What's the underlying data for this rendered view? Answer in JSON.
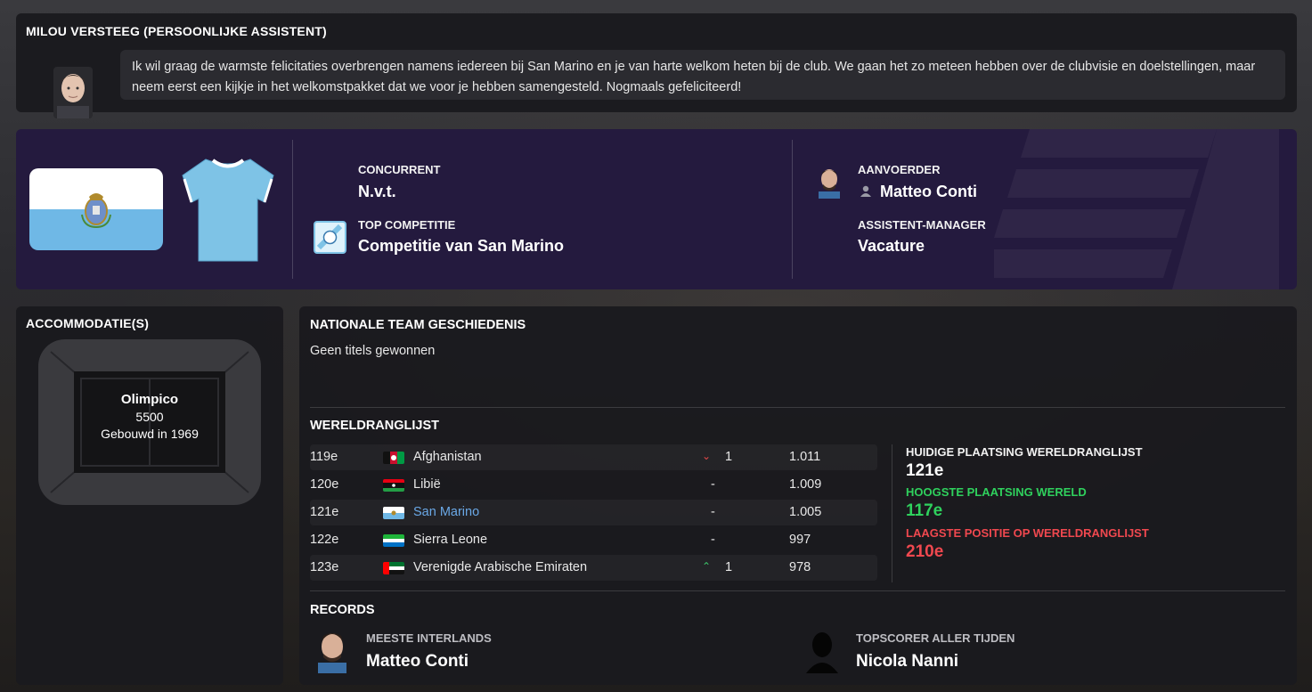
{
  "assistant_message": {
    "title": "MILOU VERSTEEG (PERSOONLIJKE ASSISTENT)",
    "text": "Ik wil graag de warmste felicitaties overbrengen namens iedereen bij San Marino en je van harte welkom heten bij de club. We gaan het zo meteen hebben over de clubvisie en doelstellingen, maar neem eerst een kijkje in het welkomstpakket dat we voor je hebben samengesteld. Nogmaals gefeliciteerd!"
  },
  "club_banner": {
    "rival_label": "CONCURRENT",
    "rival_value": "N.v.t.",
    "competition_label": "TOP COMPETITIE",
    "competition_value": "Competitie van San Marino",
    "captain_label": "AANVOERDER",
    "captain_value": "Matteo Conti",
    "assistant_manager_label": "ASSISTENT-MANAGER",
    "assistant_manager_value": "Vacature",
    "colors": {
      "banner": "#241a3e",
      "shirt": "#7ec3e6"
    }
  },
  "accommodation": {
    "title": "ACCOMMODATIE(S)",
    "stadium_name": "Olimpico",
    "capacity": "5500",
    "built": "Gebouwd in 1969"
  },
  "history": {
    "title": "NATIONALE TEAM GESCHIEDENIS",
    "text": "Geen titels gewonnen"
  },
  "world_ranking": {
    "title": "WERELDRANGLIJST",
    "rows": [
      {
        "pos": "119e",
        "country": "Afghanistan",
        "flag": "flag-afghanistan",
        "trend": "down",
        "move": "1",
        "points": "1.011"
      },
      {
        "pos": "120e",
        "country": "Libië",
        "flag": "flag-libya",
        "trend": "none",
        "move": "-",
        "points": "1.009"
      },
      {
        "pos": "121e",
        "country": "San Marino",
        "flag": "flag-san-marino",
        "trend": "none",
        "move": "-",
        "points": "1.005"
      },
      {
        "pos": "122e",
        "country": "Sierra Leone",
        "flag": "flag-sierra-leone",
        "trend": "none",
        "move": "-",
        "points": "997"
      },
      {
        "pos": "123e",
        "country": "Verenigde Arabische Emiraten",
        "flag": "flag-uae",
        "trend": "up",
        "move": "1",
        "points": "978"
      }
    ],
    "current_label": "HUIDIGE PLAATSING WERELDRANGLIJST",
    "current_value": "121e",
    "highest_label": "HOOGSTE PLAATSING WERELD",
    "highest_value": "117e",
    "lowest_label": "LAAGSTE POSITIE OP WERELDRANGLIJST",
    "lowest_value": "210e",
    "colors": {
      "highest": "#2fd15d",
      "lowest": "#f0484f"
    }
  },
  "records": {
    "title": "RECORDS",
    "most_caps_label": "MEESTE INTERLANDS",
    "most_caps_value": "Matteo Conti",
    "top_scorer_label": "TOPSCORER ALLER TIJDEN",
    "top_scorer_value": "Nicola Nanni"
  }
}
